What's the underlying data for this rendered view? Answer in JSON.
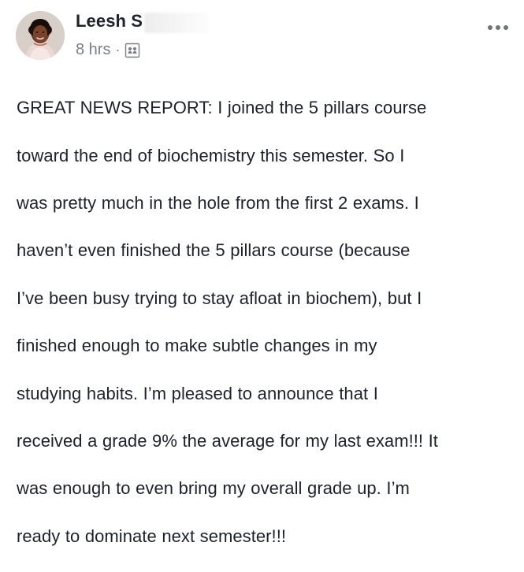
{
  "post": {
    "author_name": "Leesh S",
    "time_label": "8 hrs",
    "separator": "·",
    "body_lines": [
      "GREAT NEWS REPORT: I joined the 5 pillars course",
      "toward the end of biochemistry this semester. So I",
      "was pretty much in the hole from the first 2 exams. I",
      "haven’t even finished the 5 pillars course (because",
      "I’ve been busy trying to stay afloat in biochem), but I",
      "finished enough to make subtle changes in my",
      "studying habits. I’m pleased to announce that I",
      "received a grade 9% the average for my last exam!!! It",
      "was enough to even bring my overall grade up. I’m",
      "ready to dominate next semester!!!"
    ]
  },
  "icons": {
    "audience": "audience-group-icon",
    "more": "more-options-icon"
  },
  "colors": {
    "text_primary": "#1d2129",
    "text_secondary": "#7a7f85",
    "background": "#ffffff"
  }
}
